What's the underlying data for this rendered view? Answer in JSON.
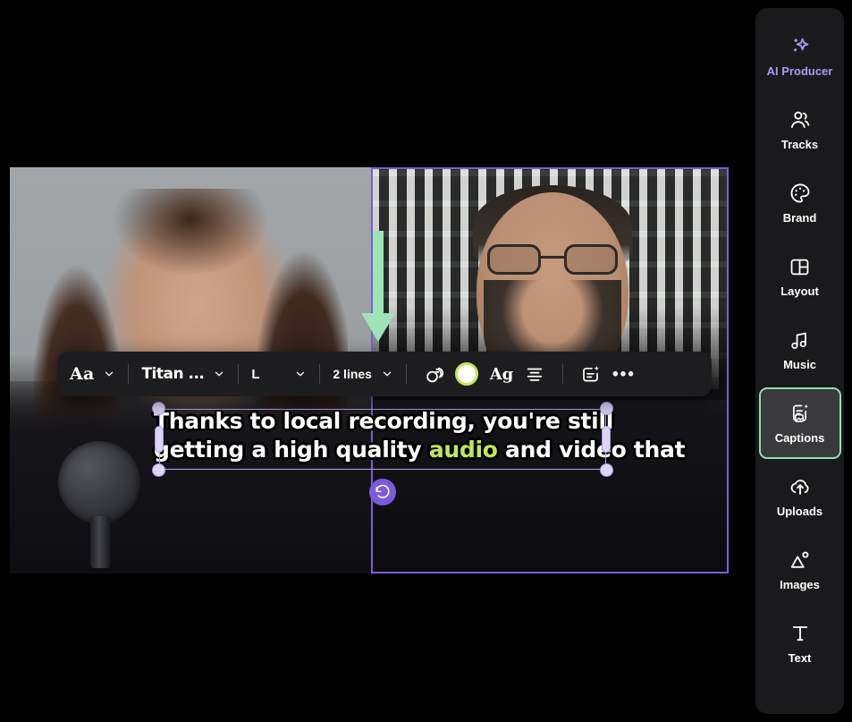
{
  "app": {
    "background": "#000000",
    "accent_purple": "#a89af5",
    "accent_green": "#8fe0b0",
    "highlight_yellow_green": "#c2e85a",
    "selection_purple": "#7b5fd4"
  },
  "canvas": {
    "name": "video-preview-canvas",
    "left_panel_label": "speaker-left",
    "right_panel_label": "speaker-right",
    "right_panel_selected": true
  },
  "annotation": {
    "arrow_direction": "down",
    "color": "#9fe3b8"
  },
  "caption": {
    "line1": "Thanks to local recording, you're still",
    "line2_before": "getting a high quality ",
    "line2_highlight": "audio",
    "line2_after": " and video that",
    "text_color": "#ffffff",
    "highlight_color": "#c2e85a",
    "stroke_color": "#000000",
    "selected": true
  },
  "toolbar": {
    "name": "caption-style-toolbar",
    "style_preset_label": "Aa",
    "font_label": "Titan ...",
    "size_label": "L",
    "lines_label": "2 lines",
    "animation_icon": "overlapping-circles-icon",
    "color_swatch": {
      "fill": "#ffffff",
      "ring": "#c2e85a"
    },
    "case_label": "Ag",
    "align_icon": "align-center-icon",
    "effects_icon": "ai-text-effects-icon",
    "more_label": "•••"
  },
  "sidebar": {
    "name": "right-tool-sidebar",
    "items": [
      {
        "label": "AI Producer",
        "icon": "sparkle-icon",
        "state": "accent"
      },
      {
        "label": "Tracks",
        "icon": "people-icon",
        "state": "normal"
      },
      {
        "label": "Brand",
        "icon": "palette-icon",
        "state": "normal"
      },
      {
        "label": "Layout",
        "icon": "layout-grid-icon",
        "state": "normal"
      },
      {
        "label": "Music",
        "icon": "music-note-icon",
        "state": "normal"
      },
      {
        "label": "Captions",
        "icon": "captions-sparkle-icon",
        "state": "active"
      },
      {
        "label": "Uploads",
        "icon": "upload-cloud-icon",
        "state": "normal"
      },
      {
        "label": "Images",
        "icon": "image-mountain-icon",
        "state": "normal"
      },
      {
        "label": "Text",
        "icon": "text-t-icon",
        "state": "normal"
      }
    ]
  }
}
